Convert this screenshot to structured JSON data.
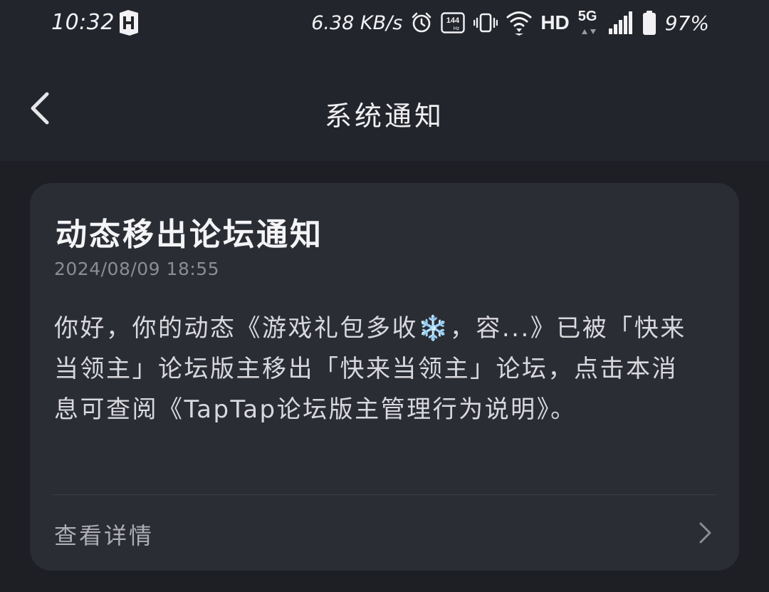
{
  "status_bar": {
    "time": "10:32",
    "network_speed": "6.38 KB/s",
    "hd_label": "HD",
    "network_type": "5G",
    "battery_percent": "97%",
    "refresh_rate": "144",
    "refresh_unit": "Hz"
  },
  "header": {
    "title": "系统通知",
    "back_icon": "chevron-left-icon"
  },
  "notification": {
    "title": "动态移出论坛通知",
    "timestamp": "2024/08/09 18:55",
    "body": "你好，你的动态《游戏礼包多收❄️，容...》已被「快来当领主」论坛版主移出「快来当领主」论坛，点击本消息可查阅《TapTap论坛版主管理行为说明》。",
    "footer_label": "查看详情",
    "footer_icon": "chevron-right-icon"
  },
  "colors": {
    "background": "#1d1f25",
    "top_panel": "#23252c",
    "card": "#2b2d35",
    "muted_text": "#8c8d94"
  }
}
